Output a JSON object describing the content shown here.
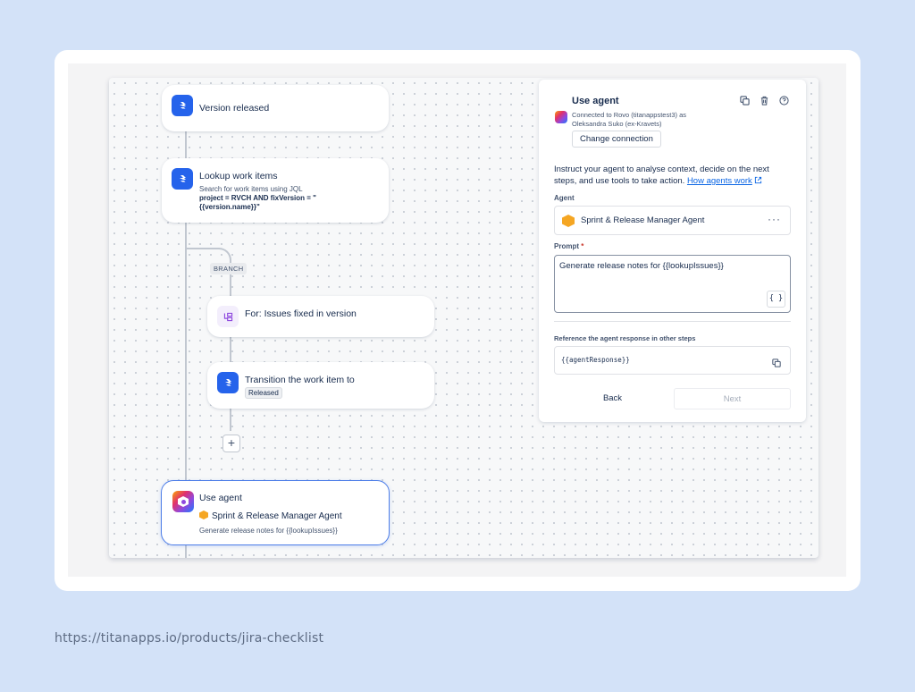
{
  "flow": {
    "trigger": {
      "title": "Version released"
    },
    "lookup": {
      "title": "Lookup work items",
      "subtitle": "Search for work items using JQL",
      "query_line1": "project = RVCH AND fixVersion = \"",
      "query_line2": "{{version.name}}\""
    },
    "branch_label": "BRANCH",
    "for_each": {
      "title": "For: Issues fixed in version"
    },
    "transition": {
      "title": "Transition the work item to",
      "status": "Released"
    },
    "add_label": "+",
    "use_agent": {
      "title": "Use agent",
      "agent_name": "Sprint & Release Manager Agent",
      "prompt": "Generate release notes for {{lookupIssues}}"
    }
  },
  "panel": {
    "title": "Use agent",
    "connection_line1": "Connected to Rovo (titanappstest3) as",
    "connection_line2": "Oleksandra Suko (ex-Kravets)",
    "change_connection": "Change connection",
    "instructions": "Instruct your agent to analyse context, decide on the next steps, and use tools to take action.",
    "instructions_link": "How agents work",
    "agent_label": "Agent",
    "agent_name": "Sprint & Release Manager Agent",
    "agent_menu": "···",
    "prompt_label": "Prompt",
    "prompt_required": "*",
    "prompt_value": "Generate release notes for {{lookupIssues}}",
    "braces": "{ }",
    "reference_label": "Reference the agent response in other steps",
    "reference_value": "{{agentResponse}}",
    "back": "Back",
    "next": "Next"
  },
  "footer": {
    "url": "https://titanapps.io/products/jira-checklist"
  },
  "colors": {
    "background": "#d3e2f8",
    "accent": "#2563eb",
    "selected_border": "#4c7de8",
    "link": "#0c66e4"
  },
  "icons": [
    "jira-icon",
    "loop-icon",
    "rovo-agent-icon",
    "copy-icon",
    "trash-icon",
    "help-icon",
    "external-link-icon"
  ]
}
